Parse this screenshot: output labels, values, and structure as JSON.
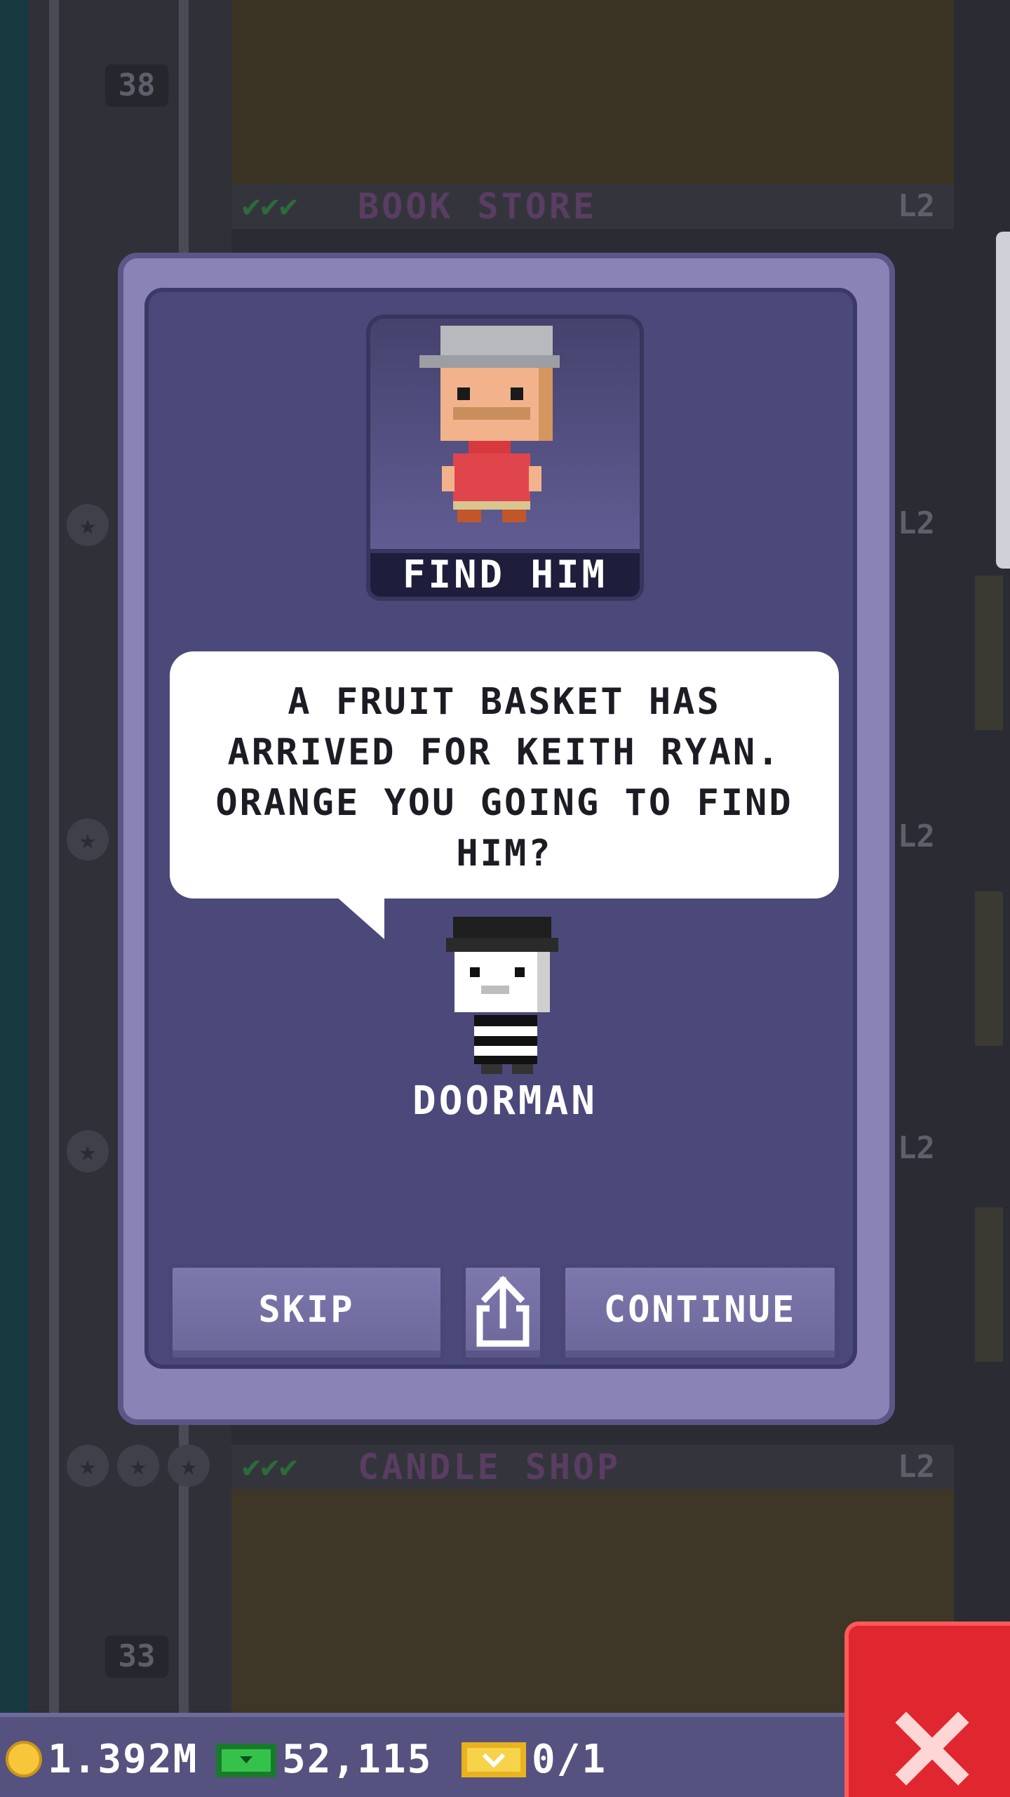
{
  "tower": {
    "floor_numbers": [
      "38",
      "33"
    ],
    "floors": [
      {
        "name": "BOOK STORE",
        "level": "L2"
      },
      {
        "name": "CANDLE SHOP",
        "level": "L2"
      }
    ],
    "side_levels": [
      "L2",
      "L2",
      "L2"
    ]
  },
  "dialog": {
    "portrait_label": "FIND HIM",
    "message": "A FRUIT BASKET HAS ARRIVED FOR KEITH RYAN. ORANGE YOU GOING TO FIND HIM?",
    "speaker": "DOORMAN",
    "buttons": {
      "skip": "SKIP",
      "share_icon": "share-icon",
      "continue": "CONTINUE"
    }
  },
  "hud": {
    "coins": "1.392M",
    "bux": "52,115",
    "tickets": "0/1"
  },
  "close_icon": "close-icon",
  "colors": {
    "dialog_frame": "#8a84b6",
    "dialog_body": "#4b487a",
    "bottom_bar": "#55527f",
    "close_button": "#e0262e"
  }
}
